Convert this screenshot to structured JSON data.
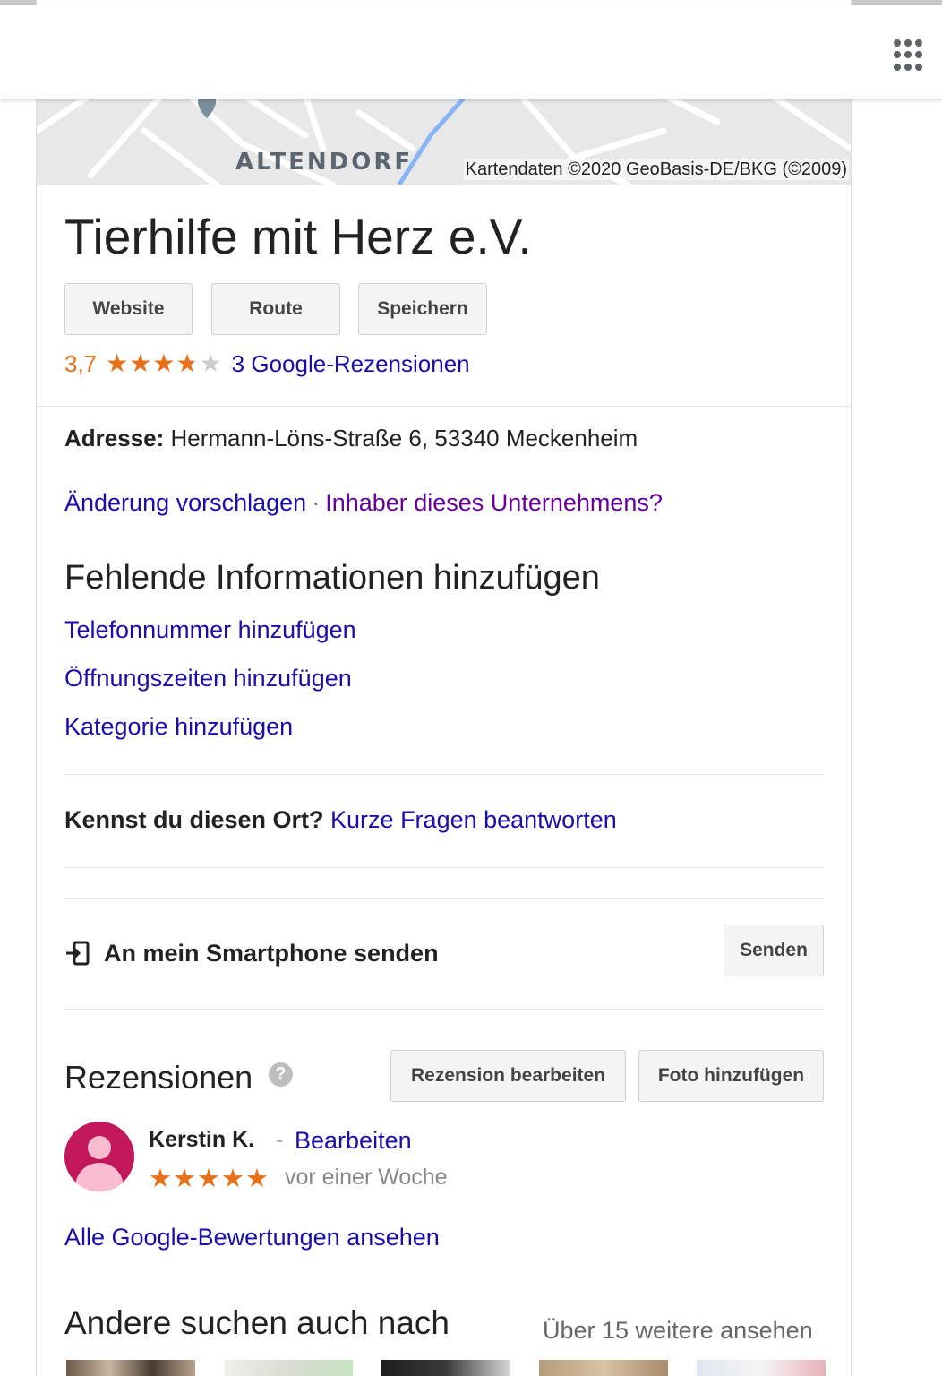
{
  "map": {
    "place_label": "ALTENDORF",
    "credit": "Kartendaten ©2020 GeoBasis-DE/BKG (©2009)"
  },
  "business": {
    "name": "Tierhilfe mit Herz e.V.",
    "buttons": {
      "website": "Website",
      "route": "Route",
      "save": "Speichern"
    },
    "rating_value": "3,7",
    "rating_fraction": 0.74,
    "reviews_link": "3 Google-Rezensionen"
  },
  "details": {
    "address_label": "Adresse:",
    "address_value": " Hermann-Löns-Straße 6, 53340 Meckenheim",
    "suggest_edit": "Änderung vorschlagen",
    "separator": "·",
    "owner_link": "Inhaber dieses Unternehmens?"
  },
  "missing_info": {
    "heading": "Fehlende Informationen hinzufügen",
    "links": [
      "Telefonnummer hinzufügen",
      "Öffnungszeiten hinzufügen",
      "Kategorie hinzufügen"
    ]
  },
  "know_place": {
    "question": "Kennst du diesen Ort?",
    "link": " Kurze Fragen beantworten"
  },
  "send_phone": {
    "label": "An mein Smartphone senden",
    "button": "Senden"
  },
  "reviews": {
    "heading": "Rezensionen",
    "help": "?",
    "edit_button": "Rezension bearbeiten",
    "photo_button": "Foto hinzufügen",
    "items": [
      {
        "name": "Kerstin K.",
        "separator": "-",
        "edit": "Bearbeiten",
        "stars": "★★★★★",
        "time": "vor einer Woche"
      }
    ],
    "all_link": "Alle Google-Bewertungen ansehen"
  },
  "others": {
    "heading": "Andere suchen auch nach",
    "more": "Über 15 weitere ansehen"
  },
  "colors": {
    "link": "#1a0dab",
    "visited": "#660099",
    "star": "#e7711b",
    "avatar": "#c2185b"
  },
  "icons": [
    "apps-grid-icon",
    "map-pin-icon",
    "send-to-phone-icon",
    "help-icon"
  ]
}
